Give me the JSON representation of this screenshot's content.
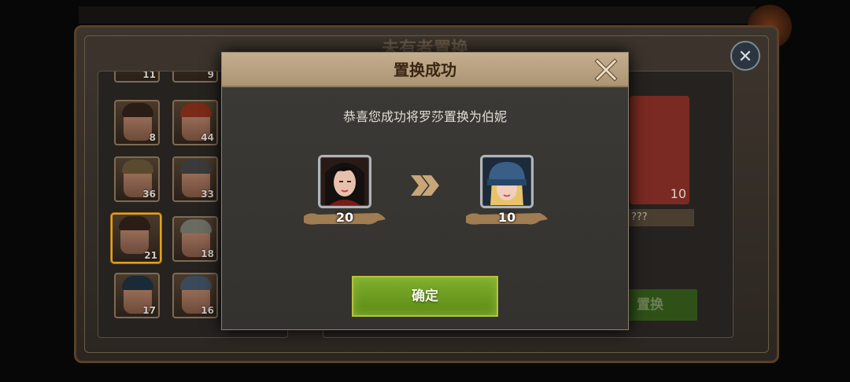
{
  "background": {
    "title": "未有者置换",
    "replace_label": "置换",
    "target_count": "10",
    "target_name": "???",
    "hero_counts": [
      "11",
      "9",
      "8",
      "44",
      "36",
      "33",
      "21",
      "18",
      "17",
      "16"
    ]
  },
  "dialog": {
    "title": "置换成功",
    "message": "恭喜您成功将罗莎置换为伯妮",
    "from_count": "20",
    "to_count": "10",
    "confirm_label": "确定"
  },
  "colors": {
    "confirm_green": "#6f9f24",
    "header_tan": "#b8a180",
    "selected_gold": "#e2a11c"
  },
  "icons": [
    "close-icon",
    "double-chevron-right-icon"
  ]
}
